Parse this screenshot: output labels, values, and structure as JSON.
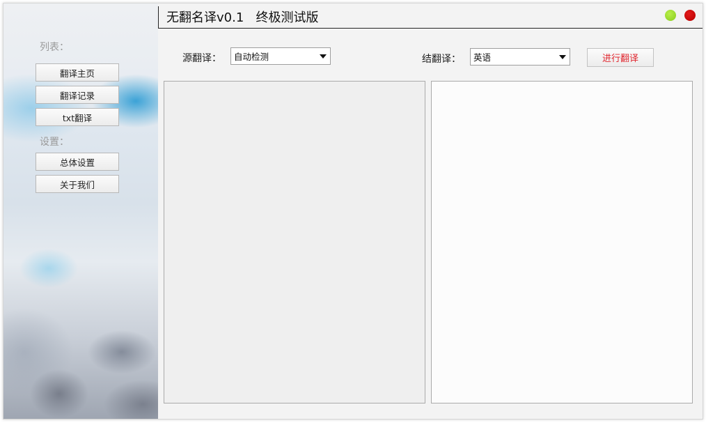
{
  "window": {
    "title": "无翻名译v0.1   终极测试版"
  },
  "sidebar": {
    "list_heading": "列表：",
    "settings_heading": "设置：",
    "items": [
      {
        "label": "翻译主页"
      },
      {
        "label": "翻译记录"
      },
      {
        "label": "txt翻译"
      }
    ],
    "settings_items": [
      {
        "label": "总体设置"
      },
      {
        "label": "关于我们"
      }
    ]
  },
  "toolbar": {
    "source_label": "源翻译：",
    "source_value": "自动检测",
    "target_label": "结翻译：",
    "target_value": "英语",
    "translate_button": "进行翻译"
  },
  "editor": {
    "source_text": "",
    "result_text": ""
  },
  "colors": {
    "accent_text": "#e0252d",
    "minimize_dot": "#9edc2a",
    "close_dot": "#cc0000"
  }
}
